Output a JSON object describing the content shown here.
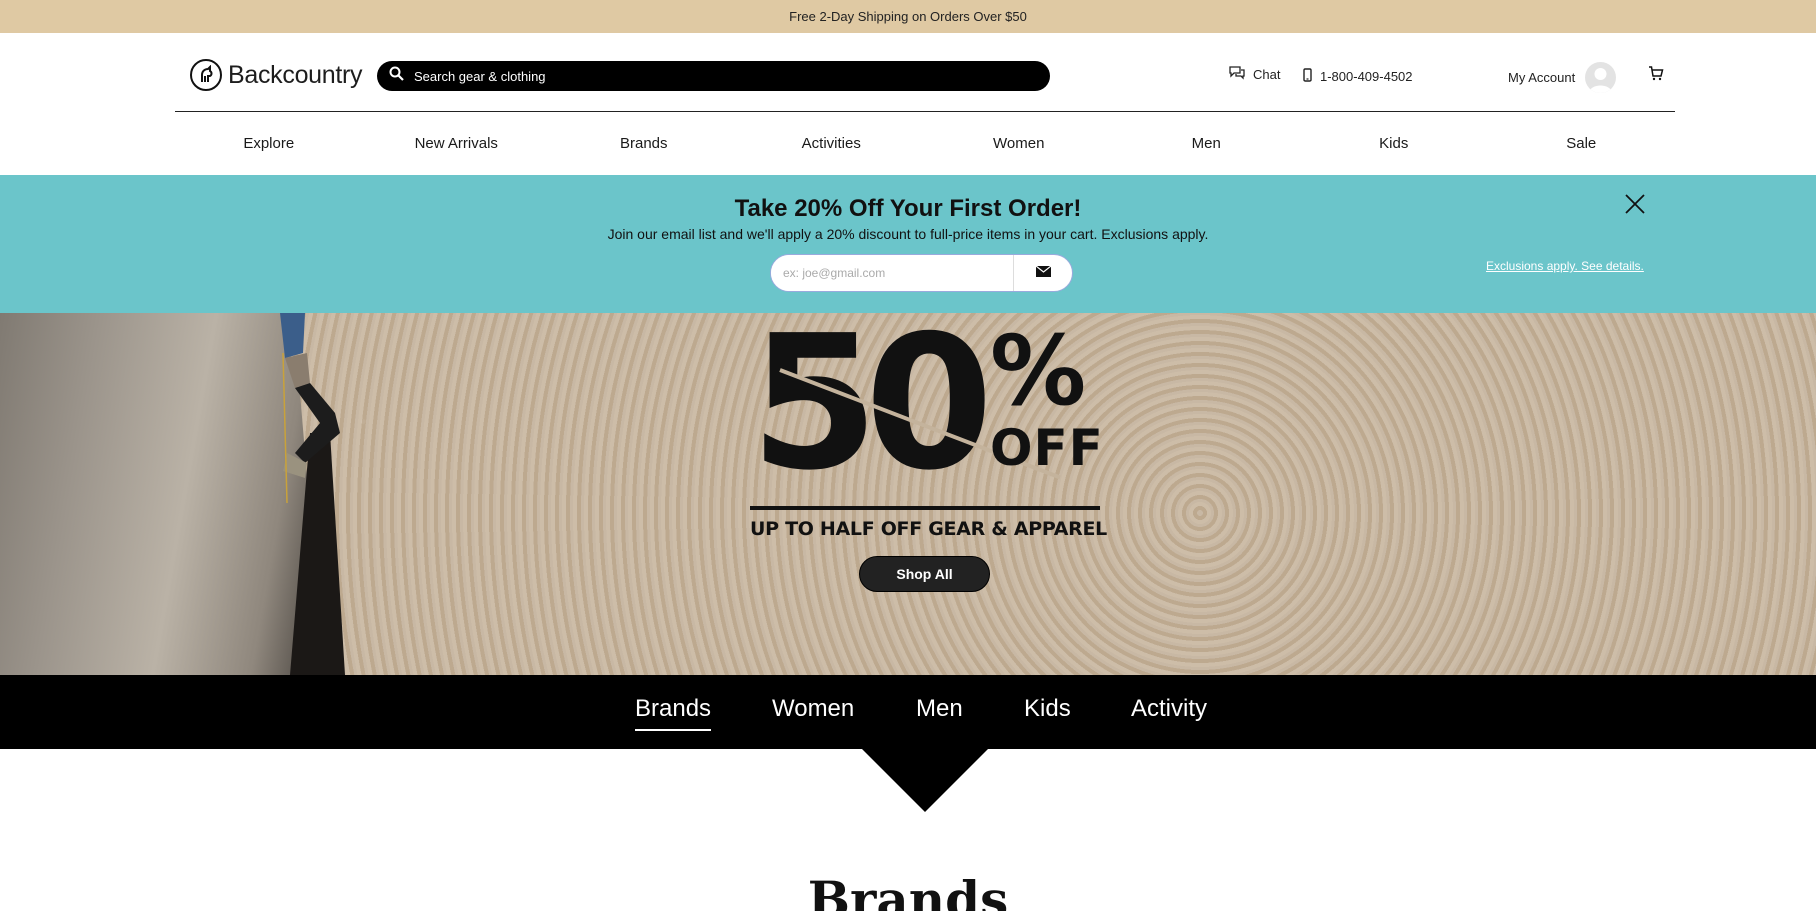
{
  "topbar": {
    "text": "Free 2-Day Shipping on Orders Over $50"
  },
  "header": {
    "logo_text": "Backcountry",
    "search_placeholder": "Search gear & clothing",
    "chat_label": "Chat",
    "phone_label": "1-800-409-4502",
    "account_label": "My Account"
  },
  "nav": {
    "items": [
      {
        "label": "Explore"
      },
      {
        "label": "New Arrivals"
      },
      {
        "label": "Brands"
      },
      {
        "label": "Activities"
      },
      {
        "label": "Women"
      },
      {
        "label": "Men"
      },
      {
        "label": "Kids"
      },
      {
        "label": "Sale"
      }
    ]
  },
  "promo": {
    "title": "Take 20% Off Your First Order!",
    "subtitle": "Join our email list and we'll apply a 20% discount to full-price items in your cart. Exclusions apply.",
    "email_placeholder": "ex: joe@gmail.com",
    "details_link": "Exclusions apply. See details.",
    "bg_color": "#6bc5ca"
  },
  "hero": {
    "big_number": "50",
    "percent": "%",
    "off": "OFF",
    "tagline": "UP TO HALF OFF GEAR & APPAREL",
    "cta": "Shop All"
  },
  "category_tabs": {
    "items": [
      {
        "label": "Brands",
        "active": true
      },
      {
        "label": "Women",
        "active": false
      },
      {
        "label": "Men",
        "active": false
      },
      {
        "label": "Kids",
        "active": false
      },
      {
        "label": "Activity",
        "active": false
      }
    ]
  },
  "section": {
    "title": "Brands"
  },
  "colors": {
    "topbar": "#dfc9a3",
    "promo": "#6bc5ca",
    "nav_dark": "#000000"
  }
}
